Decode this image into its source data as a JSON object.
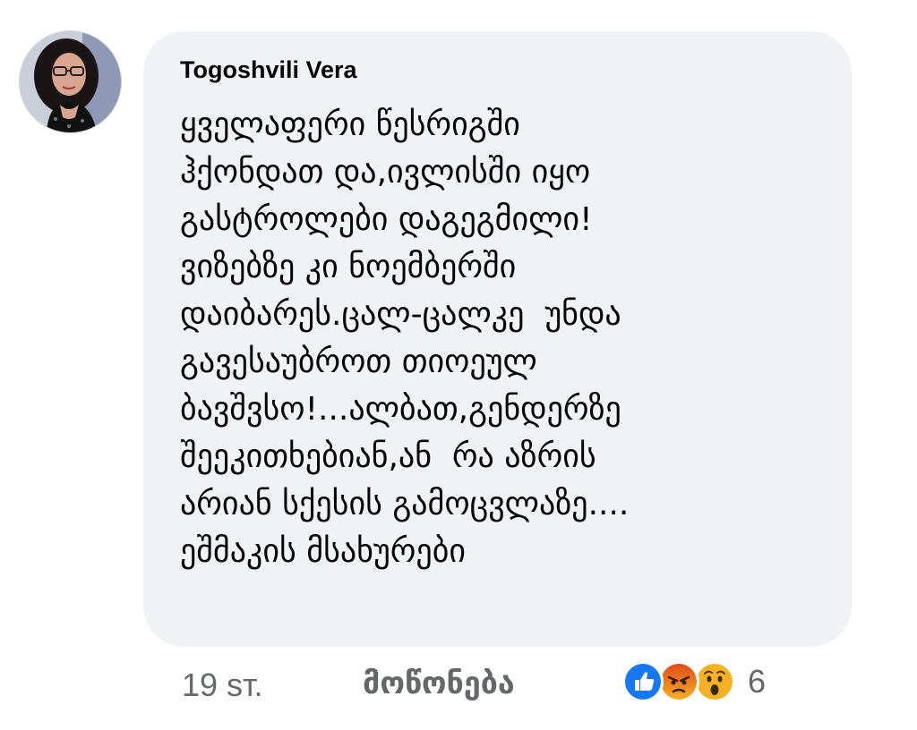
{
  "comment": {
    "author": "Togoshvili Vera",
    "lines": [
      "ყველაფერი წესრიგში",
      "ჰქონდათ და,ივლისში იყო",
      "გასტროლები დაგეგმილი!",
      "ვიზებზე კი ნოემბერში",
      "დაიბარეს.ცალ-ცალკე  უნდა",
      "გავესაუბროთ თიოეულ",
      "ბავშვსო!...ალბათ,გენდერზე",
      "შეეკითხებიან,ან  რა აზრის",
      "არიან სქესის გამოცვლაზე....",
      "ეშმაკის მსახურები"
    ]
  },
  "actions": {
    "time": "19 ѕт.",
    "like_label": "მოწონება",
    "reaction_count": "6",
    "reactions": [
      "like-icon",
      "angry-icon",
      "wow-icon"
    ]
  },
  "colors": {
    "bubble": "#f0f2f5",
    "text": "#050505",
    "secondary": "#65676b",
    "like_blue": "#1877f2",
    "angry_orange": "#e9710f",
    "wow_yellow": "#f7b125"
  }
}
